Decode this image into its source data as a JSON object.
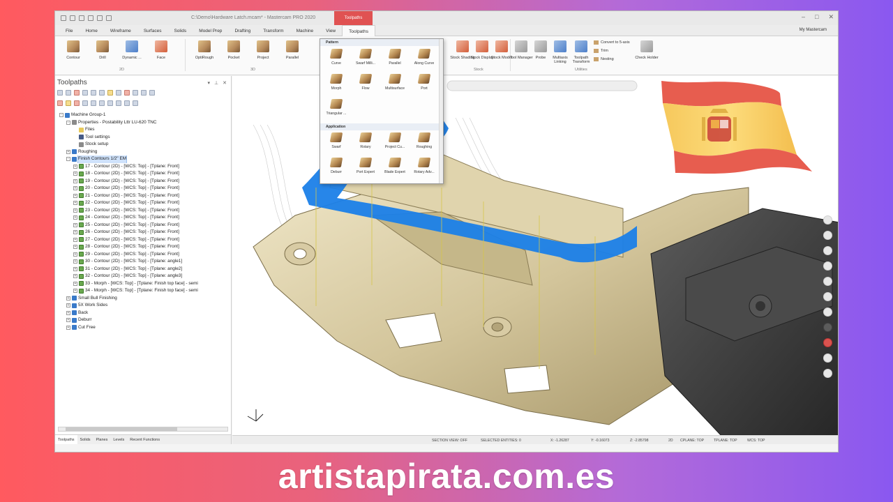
{
  "window": {
    "title": "C:\\Demo\\Hardware Latch.mcam* - Mastercam PRO 2020",
    "context_tab": "Toolpaths",
    "account": "My Mastercam"
  },
  "tabs": [
    "File",
    "Home",
    "Wireframe",
    "Surfaces",
    "Solids",
    "Model Prep",
    "Drafting",
    "Transform",
    "Machine",
    "View",
    "Toolpaths"
  ],
  "ribbon": {
    "two_d_buttons": [
      "Contour",
      "Drill",
      "Dynamic ...",
      "Face"
    ],
    "three_d_buttons": [
      "OptiRough",
      "Pocket",
      "Project",
      "Parallel"
    ],
    "group_2d": "2D",
    "group_3d": "3D",
    "stock_buttons": [
      "Stock Shading",
      "Stock Display",
      "Stock Model"
    ],
    "group_stock": "Stock",
    "utility_buttons": [
      "Tool Manager",
      "Probe",
      "Multiaxis Linking",
      "Toolpath Transform"
    ],
    "utility_small": [
      "Convert to 5-axis",
      "Trim",
      "Nesting"
    ],
    "check_holder": "Check Holder",
    "group_utilities": "Utilities"
  },
  "gallery": {
    "pattern_header": "Pattern",
    "pattern_items": [
      "Curve",
      "Swarf Milli...",
      "Parallel",
      "Along Curve",
      "Morph",
      "Flow",
      "Multisurface",
      "Port",
      "Triangular ..."
    ],
    "application_header": "Application",
    "application_items": [
      "Swarf",
      "Rotary",
      "Project Cu...",
      "Roughing",
      "Deburr",
      "Port Expert",
      "Blade Expert",
      "Rotary Adv..."
    ]
  },
  "left_panel": {
    "title": "Toolpaths",
    "tree": [
      {
        "label": "Machine Group-1",
        "level": 0,
        "icon": "grp",
        "exp": "-"
      },
      {
        "label": "Properties - Postability Lttr LU-620 TNC",
        "level": 1,
        "icon": "prop",
        "exp": "-"
      },
      {
        "label": "Files",
        "level": 2,
        "icon": "file",
        "exp": ""
      },
      {
        "label": "Tool settings",
        "level": 2,
        "icon": "tool",
        "exp": ""
      },
      {
        "label": "Stock setup",
        "level": 2,
        "icon": "prop",
        "exp": ""
      },
      {
        "label": "Roughing",
        "level": 1,
        "icon": "grp",
        "exp": "+"
      },
      {
        "label": "Finish Contours 1/2\" EM",
        "level": 1,
        "icon": "grp",
        "exp": "-",
        "selected": true
      },
      {
        "label": "17 - Contour (2D) - [WCS: Top] - [Tplane: Front]",
        "level": 2,
        "icon": "op",
        "exp": "+"
      },
      {
        "label": "18 - Contour (2D) - [WCS: Top] - [Tplane: Front]",
        "level": 2,
        "icon": "op",
        "exp": "+"
      },
      {
        "label": "19 - Contour (2D) - [WCS: Top] - [Tplane: Front]",
        "level": 2,
        "icon": "op",
        "exp": "+"
      },
      {
        "label": "20 - Contour (2D) - [WCS: Top] - [Tplane: Front]",
        "level": 2,
        "icon": "op",
        "exp": "+"
      },
      {
        "label": "21 - Contour (2D) - [WCS: Top] - [Tplane: Front]",
        "level": 2,
        "icon": "op",
        "exp": "+"
      },
      {
        "label": "22 - Contour (2D) - [WCS: Top] - [Tplane: Front]",
        "level": 2,
        "icon": "op",
        "exp": "+"
      },
      {
        "label": "23 - Contour (2D) - [WCS: Top] - [Tplane: Front]",
        "level": 2,
        "icon": "op",
        "exp": "+"
      },
      {
        "label": "24 - Contour (2D) - [WCS: Top] - [Tplane: Front]",
        "level": 2,
        "icon": "op",
        "exp": "+"
      },
      {
        "label": "25 - Contour (2D) - [WCS: Top] - [Tplane: Front]",
        "level": 2,
        "icon": "op",
        "exp": "+"
      },
      {
        "label": "26 - Contour (2D) - [WCS: Top] - [Tplane: Front]",
        "level": 2,
        "icon": "op",
        "exp": "+"
      },
      {
        "label": "27 - Contour (2D) - [WCS: Top] - [Tplane: Front]",
        "level": 2,
        "icon": "op",
        "exp": "+"
      },
      {
        "label": "28 - Contour (2D) - [WCS: Top] - [Tplane: Front]",
        "level": 2,
        "icon": "op",
        "exp": "+"
      },
      {
        "label": "29 - Contour (2D) - [WCS: Top] - [Tplane: Front]",
        "level": 2,
        "icon": "op",
        "exp": "+"
      },
      {
        "label": "30 - Contour (2D) - [WCS: Top] - [Tplane: angle1]",
        "level": 2,
        "icon": "op",
        "exp": "+"
      },
      {
        "label": "31 - Contour (2D) - [WCS: Top] - [Tplane: angle2]",
        "level": 2,
        "icon": "op",
        "exp": "+"
      },
      {
        "label": "32 - Contour (2D) - [WCS: Top] - [Tplane: angle3]",
        "level": 2,
        "icon": "op",
        "exp": "+"
      },
      {
        "label": "33 - Morph - [WCS: Top] - [Tplane: Finish top face] - semi",
        "level": 2,
        "icon": "op",
        "exp": "+"
      },
      {
        "label": "34 - Morph - [WCS: Top] - [Tplane: Finish top face] - semi",
        "level": 2,
        "icon": "op",
        "exp": "+"
      },
      {
        "label": "Small Bull Finishing",
        "level": 1,
        "icon": "grp",
        "exp": "+"
      },
      {
        "label": "5X Work Sides",
        "level": 1,
        "icon": "grp",
        "exp": "+"
      },
      {
        "label": "Back",
        "level": 1,
        "icon": "grp",
        "exp": "+"
      },
      {
        "label": "Deburr",
        "level": 1,
        "icon": "grp",
        "exp": "+"
      },
      {
        "label": "Cut Free",
        "level": 1,
        "icon": "grp",
        "exp": "+"
      }
    ],
    "bottom_tabs": [
      "Toolpaths",
      "Solids",
      "Planes",
      "Levels",
      "Recent Functions"
    ]
  },
  "status_bar": {
    "section_view": "SECTION VIEW: OFF",
    "selected": "SELECTED ENTITIES: 0",
    "x": "X:  -1.26287",
    "y": "Y:  -0.16073",
    "z": "Z:  -2.85798",
    "mode": "2D",
    "cplane": "CPLANE: TOP",
    "tplane": "TPLANE: TOP",
    "wcs": "WCS: TOP"
  },
  "site": {
    "text": "artistapirata.com.es"
  },
  "colors": {
    "toolpath_blue": "#1b7fe8",
    "part": "#d8cba4",
    "vise": "#3f3f3f",
    "flag_red": "#e44b3c",
    "flag_yellow": "#f7c43e"
  }
}
